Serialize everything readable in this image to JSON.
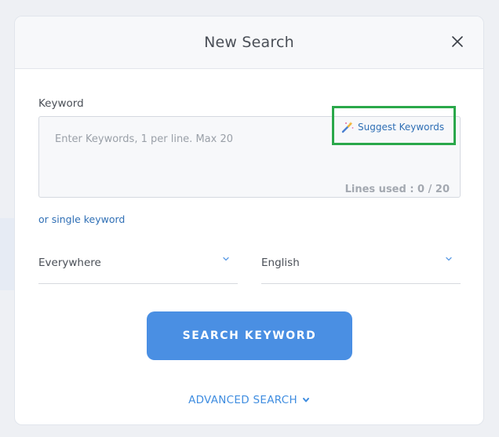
{
  "modal": {
    "title": "New Search"
  },
  "keyword": {
    "label": "Keyword",
    "placeholder": "Enter Keywords, 1 per line. Max 20",
    "suggest_label": "Suggest Keywords",
    "lines_used": "Lines used : 0 / 20",
    "single_keyword_label": "or single keyword"
  },
  "filters": {
    "location": "Everywhere",
    "language": "English"
  },
  "actions": {
    "search_label": "SEARCH KEYWORD",
    "advanced_label": "ADVANCED SEARCH"
  },
  "colors": {
    "accent": "#4a8fe3",
    "link": "#2f6fb5",
    "highlight": "#2aa84a"
  },
  "icons": {
    "close": "close-icon",
    "suggest": "magic-wand-icon",
    "dropdown": "chevron-down-icon"
  }
}
